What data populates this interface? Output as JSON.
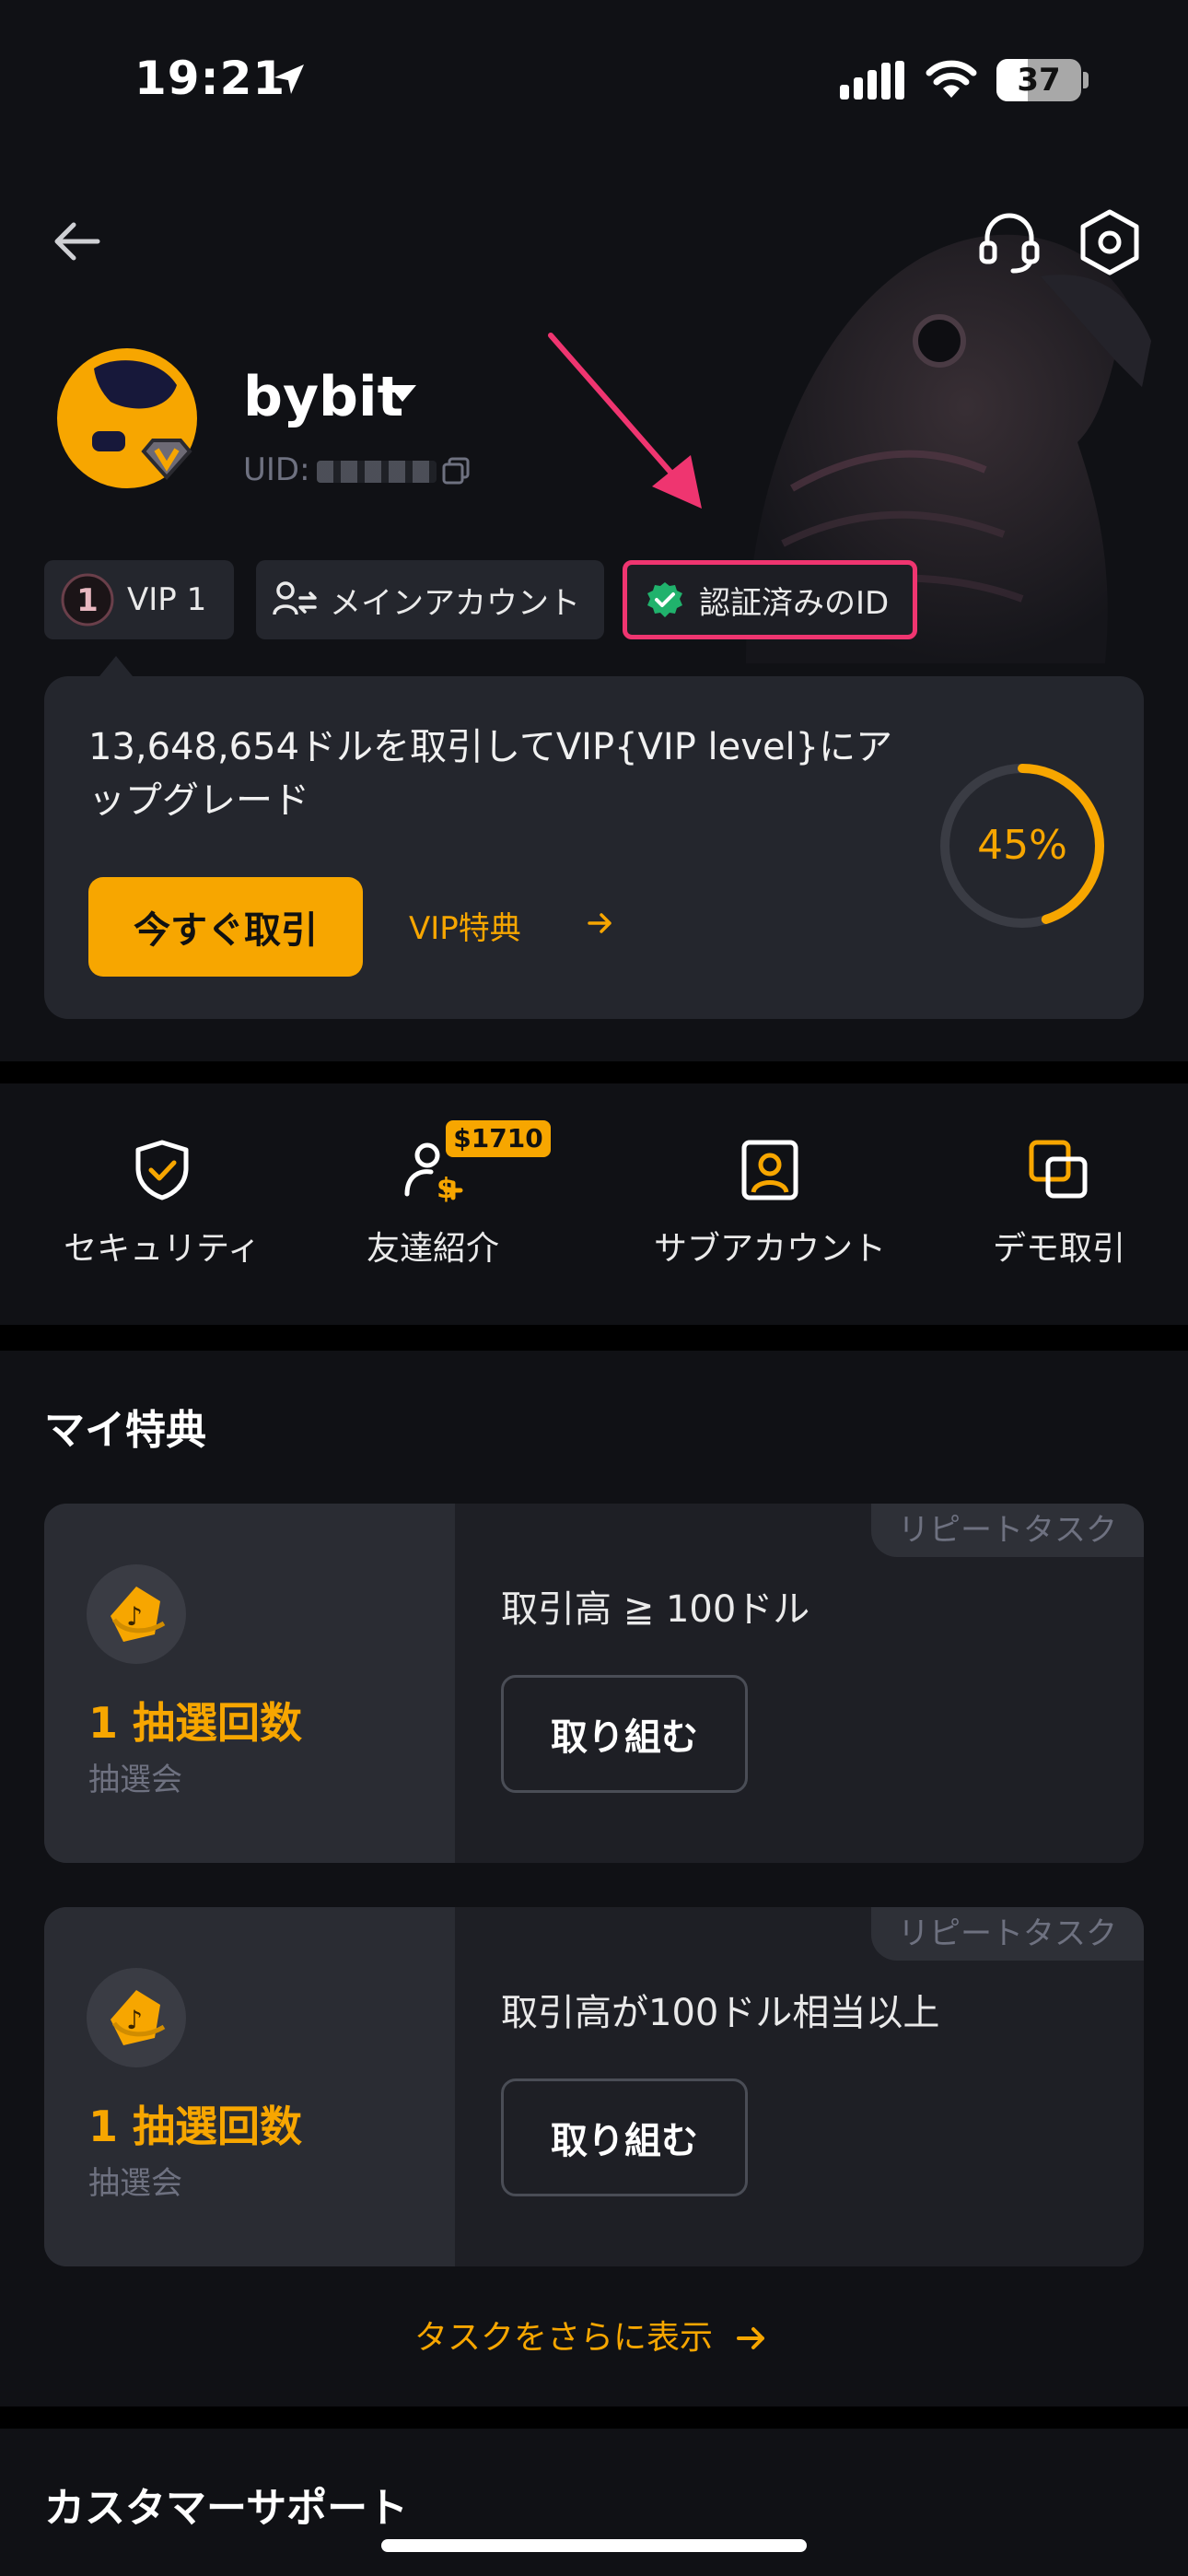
{
  "status_bar": {
    "time": "19:21",
    "battery": "37",
    "battery_level": 0.37
  },
  "header": {
    "username": "bybit",
    "uid_label": "UID:",
    "chips": {
      "vip": "VIP 1",
      "main_account": "メインアカウント",
      "verified": "認証済みのID"
    },
    "vip_badge_number": "1"
  },
  "vip_card": {
    "message": "13,648,654ドルを取引してVIP{VIP level}にアップグレード",
    "trade_button": "今すぐ取引",
    "benefit_link": "VIP特典",
    "progress_text": "45%",
    "progress_value": 0.45
  },
  "quick_actions": [
    {
      "label": "セキュリティ",
      "icon": "shield-check-icon"
    },
    {
      "label": "友達紹介",
      "icon": "referral-icon",
      "badge": "$1710"
    },
    {
      "label": "サブアカウント",
      "icon": "sub-account-icon"
    },
    {
      "label": "デモ取引",
      "icon": "demo-trade-icon"
    }
  ],
  "benefits": {
    "title": "マイ特典",
    "tasks": [
      {
        "tag": "リピートタスク",
        "count": "1 抽選回数",
        "sub": "抽選会",
        "condition": "取引高 ≧ 100ドル",
        "button": "取り組む"
      },
      {
        "tag": "リピートタスク",
        "count": "1 抽選回数",
        "sub": "抽選会",
        "condition": "取引高が100ドル相当以上",
        "button": "取り組む"
      }
    ],
    "more_link": "タスクをさらに表示"
  },
  "support": {
    "title": "カスタマーサポート"
  },
  "colors": {
    "accent": "#f7a600",
    "background": "#101115",
    "card": "#24262d",
    "highlight": "#ef3570",
    "verified": "#20b26c"
  }
}
